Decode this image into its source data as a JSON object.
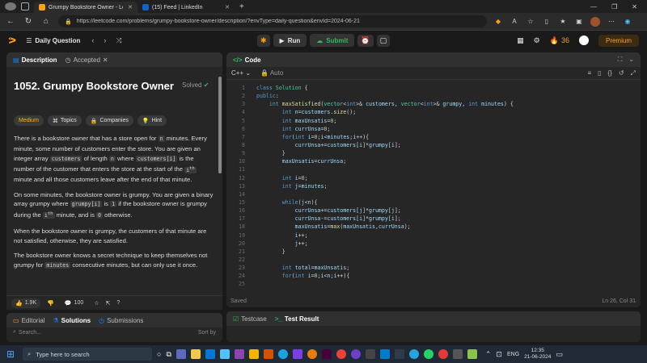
{
  "browser": {
    "tabs": [
      {
        "title": "Grumpy Bookstore Owner - Leet",
        "active": true
      },
      {
        "title": "(15) Feed | LinkedIn",
        "active": false
      }
    ],
    "url": "https://leetcode.com/problems/grumpy-bookstore-owner/description/?envType=daily-question&envId=2024-06-21"
  },
  "header": {
    "daily": "Daily Question",
    "run": "Run",
    "submit": "Submit",
    "streak": "36",
    "premium": "Premium"
  },
  "left": {
    "tab_description": "Description",
    "tab_accepted": "Accepted",
    "title": "1052. Grumpy Bookstore Owner",
    "solved": "Solved",
    "chips": [
      "Medium",
      "Topics",
      "Companies",
      "Hint"
    ],
    "likes": "1.9K",
    "comments": "100",
    "bottom_tabs": [
      "Editorial",
      "Solutions",
      "Submissions"
    ],
    "search_placeholder": "Search...",
    "sort": "Sort by"
  },
  "code": {
    "tab": "Code",
    "lang": "C++",
    "auto": "Auto",
    "saved": "Saved",
    "pos": "Ln 26, Col 31"
  },
  "testcase": {
    "tab1": "Testcase",
    "tab2": "Test Result"
  },
  "taskbar": {
    "search": "Type here to search",
    "lang": "ENG",
    "time": "12:35",
    "date": "21-06-2024"
  },
  "colors": {
    "accent": "#ffa116",
    "green": "#2cbb5d",
    "blue": "#0a84ff"
  }
}
